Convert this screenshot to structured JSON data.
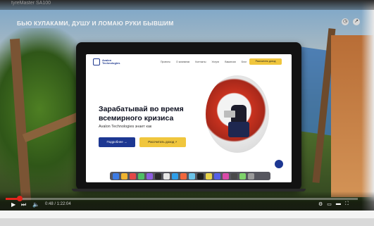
{
  "top_bar": {
    "channel": "tyreMaster SA100"
  },
  "video": {
    "title": "БЬЮ КУЛАКАМИ, ДУШУ И ЛОМАЮ РУКИ БЫВШИМ",
    "progress_fraction": 0.04
  },
  "website": {
    "logo_text": "Avalon Technologies",
    "menu": [
      "Проекты",
      "О компании",
      "Контакты",
      "Услуги",
      "Вакансии",
      "Блог"
    ],
    "nav_button": "Рассчитать доход",
    "hero_title": "Зарабатывай во время всемирного кризиса",
    "hero_subtitle": "Avalon Technologies знает как",
    "primary_button": "Подробнее  →",
    "secondary_button": "Рассчитать доход  ⚡"
  },
  "player": {
    "time": "0:48 / 1:22:04",
    "play_icon": "play-icon",
    "next_icon": "next-icon",
    "volume_icon": "volume-icon"
  },
  "bottom": {
    "left_text": "",
    "right_text": ""
  },
  "colors": {
    "accent_red": "#e3251c",
    "brand_blue": "#1d3792",
    "brand_yellow": "#f0c63d"
  }
}
